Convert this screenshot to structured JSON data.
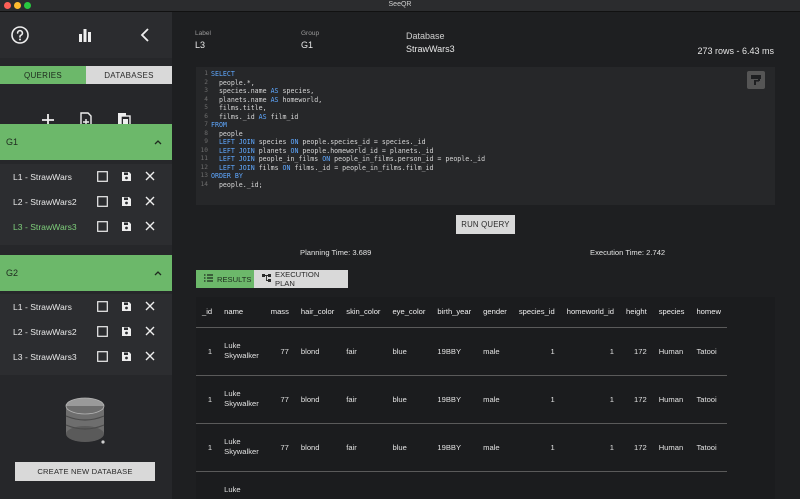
{
  "window": {
    "title": "SeeQR"
  },
  "sidebar": {
    "tabs": [
      "QUERIES",
      "DATABASES"
    ],
    "groups": [
      {
        "name": "G1",
        "queries": [
          {
            "label": "L1 - StrawWars",
            "active": false
          },
          {
            "label": "L2 - StrawWars2",
            "active": false
          },
          {
            "label": "L3 - StrawWars3",
            "active": true
          }
        ]
      },
      {
        "name": "G2",
        "queries": [
          {
            "label": "L1 - StrawWars",
            "active": false
          },
          {
            "label": "L2 - StrawWars2",
            "active": false
          },
          {
            "label": "L3 - StrawWars3",
            "active": false
          }
        ]
      }
    ],
    "create_db_label": "CREATE NEW DATABASE"
  },
  "main": {
    "label_caption": "Label",
    "label_value": "L3",
    "group_caption": "Group",
    "group_value": "G1",
    "db_caption": "Database",
    "db_value": "StrawWars3",
    "rows_info": "273 rows - 6.43 ms",
    "run_label": "RUN QUERY",
    "planning_time": "Planning Time: 3.689",
    "execution_time": "Execution Time: 2.742",
    "result_tabs": [
      "RESULTS",
      "EXECUTION PLAN"
    ]
  },
  "editor": {
    "lines": [
      "SELECT",
      "  people.*,",
      "  species.name AS species,",
      "  planets.name AS homeworld,",
      "  films.title,",
      "  films._id AS film_id",
      "FROM",
      "  people",
      "  LEFT JOIN species ON people.species_id = species._id",
      "  LEFT JOIN planets ON people.homeworld_id = planets._id",
      "  LEFT JOIN people_in_films ON people_in_films.person_id = people._id",
      "  LEFT JOIN films ON films._id = people_in_films.film_id",
      "ORDER BY",
      "  people._id;"
    ]
  },
  "table": {
    "columns": [
      "_id",
      "name",
      "mass",
      "hair_color",
      "skin_color",
      "eye_color",
      "birth_year",
      "gender",
      "species_id",
      "homeworld_id",
      "height",
      "species",
      "homew"
    ],
    "rows": [
      [
        "1",
        "Luke Skywalker",
        "77",
        "blond",
        "fair",
        "blue",
        "19BBY",
        "male",
        "1",
        "1",
        "172",
        "Human",
        "Tatooi"
      ],
      [
        "1",
        "Luke Skywalker",
        "77",
        "blond",
        "fair",
        "blue",
        "19BBY",
        "male",
        "1",
        "1",
        "172",
        "Human",
        "Tatooi"
      ],
      [
        "1",
        "Luke Skywalker",
        "77",
        "blond",
        "fair",
        "blue",
        "19BBY",
        "male",
        "1",
        "1",
        "172",
        "Human",
        "Tatooi"
      ],
      [
        "",
        "Luke",
        "",
        "",
        "",
        "",
        "",
        "",
        "",
        "",
        "",
        "",
        ""
      ]
    ]
  },
  "colors": {
    "accent": "#6cb86a",
    "keyword": "#5fa8ff"
  }
}
